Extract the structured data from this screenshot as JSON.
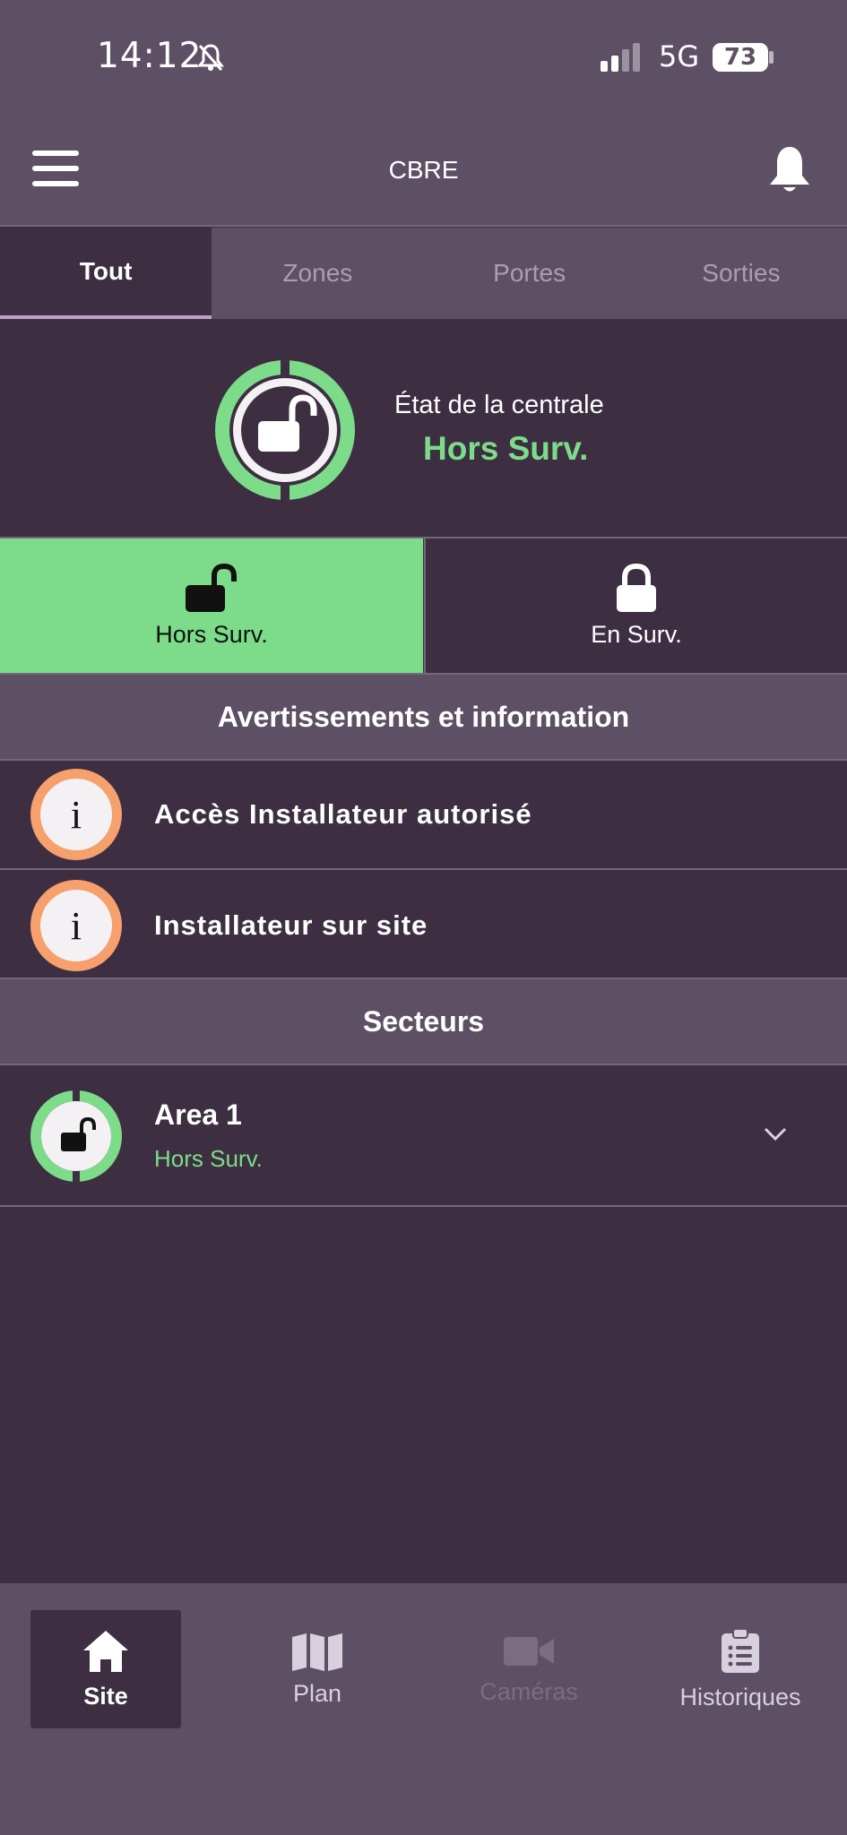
{
  "status_bar": {
    "time": "14:12",
    "network": "5G",
    "battery": "73"
  },
  "header": {
    "title": "CBRE"
  },
  "tabs": [
    {
      "label": "Tout",
      "active": true
    },
    {
      "label": "Zones"
    },
    {
      "label": "Portes"
    },
    {
      "label": "Sorties"
    }
  ],
  "panel": {
    "state_label": "État de la centrale",
    "state_value": "Hors Surv."
  },
  "arm_buttons": {
    "disarm_label": "Hors Surv.",
    "arm_label": "En Surv."
  },
  "warnings": {
    "title": "Avertissements et information",
    "items": [
      {
        "text": "Accès Installateur autorisé",
        "icon": "info-icon"
      },
      {
        "text": "Installateur sur site",
        "icon": "info-icon"
      }
    ]
  },
  "sectors": {
    "title": "Secteurs",
    "items": [
      {
        "name": "Area 1",
        "state": "Hors Surv."
      }
    ]
  },
  "bottom_nav": [
    {
      "label": "Site",
      "icon": "home-icon",
      "active": true
    },
    {
      "label": "Plan",
      "icon": "map-icon"
    },
    {
      "label": "Caméras",
      "icon": "video-camera-icon",
      "disabled": true
    },
    {
      "label": "Historiques",
      "icon": "clipboard-list-icon"
    }
  ],
  "colors": {
    "accent_green": "#7ddc8a",
    "info_orange": "#f5a06d",
    "background": "#3d2f41",
    "bar": "#5e5064"
  }
}
